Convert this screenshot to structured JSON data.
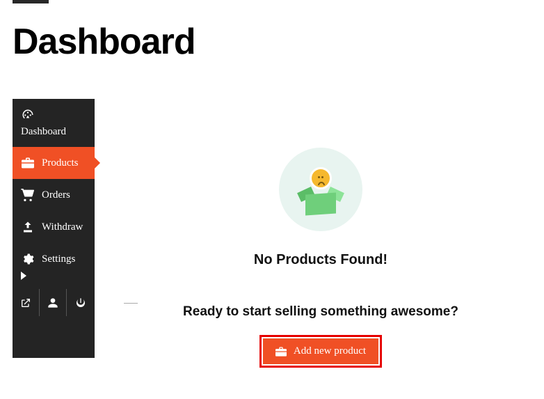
{
  "page_title": "Dashboard",
  "sidebar": {
    "items": [
      {
        "label": "Dashboard",
        "icon": "dashboard-icon",
        "active": false
      },
      {
        "label": "Products",
        "icon": "briefcase-icon",
        "active": true
      },
      {
        "label": "Orders",
        "icon": "cart-icon",
        "active": false
      },
      {
        "label": "Withdraw",
        "icon": "upload-icon",
        "active": false
      },
      {
        "label": "Settings",
        "icon": "gear-icon",
        "active": false,
        "has_chevron": true
      }
    ],
    "footer_icons": [
      "external-link-icon",
      "user-icon",
      "power-icon"
    ]
  },
  "main": {
    "empty_heading": "No Products Found!",
    "empty_subtext": "Ready to start selling something awesome?",
    "add_button_label": "Add new product"
  },
  "colors": {
    "accent": "#f05025",
    "highlight_border": "#e60000",
    "sidebar_bg": "#242424"
  }
}
